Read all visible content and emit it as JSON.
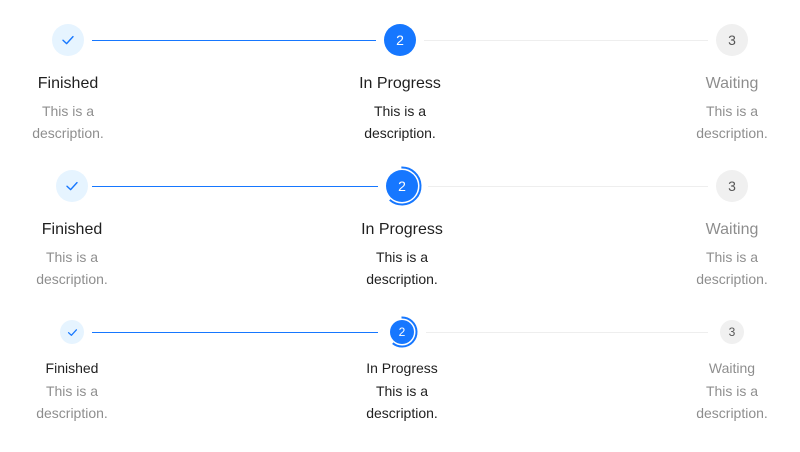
{
  "rows": [
    {
      "steps": [
        {
          "title": "Finished",
          "description": "This is a description.",
          "status": "finish",
          "icon": "check-icon"
        },
        {
          "title": "In Progress",
          "description": "This is a description.",
          "status": "process",
          "number": "2"
        },
        {
          "title": "Waiting",
          "description": "This is a description.",
          "status": "wait",
          "number": "3"
        }
      ]
    },
    {
      "steps": [
        {
          "title": "Finished",
          "description": "This is a description.",
          "status": "finish",
          "icon": "check-icon"
        },
        {
          "title": "In Progress",
          "description": "This is a description.",
          "status": "process",
          "number": "2"
        },
        {
          "title": "Waiting",
          "description": "This is a description.",
          "status": "wait",
          "number": "3"
        }
      ]
    },
    {
      "steps": [
        {
          "title": "Finished",
          "description": "This is a description.",
          "status": "finish",
          "icon": "check-icon"
        },
        {
          "title": "In Progress",
          "description": "This is a description.",
          "status": "process",
          "number": "2"
        },
        {
          "title": "Waiting",
          "description": "This is a description.",
          "status": "wait",
          "number": "3"
        }
      ]
    }
  ],
  "colors": {
    "primary": "#1677ff",
    "finish_bg": "#e6f4ff",
    "wait_bg": "#f0f0f0"
  }
}
